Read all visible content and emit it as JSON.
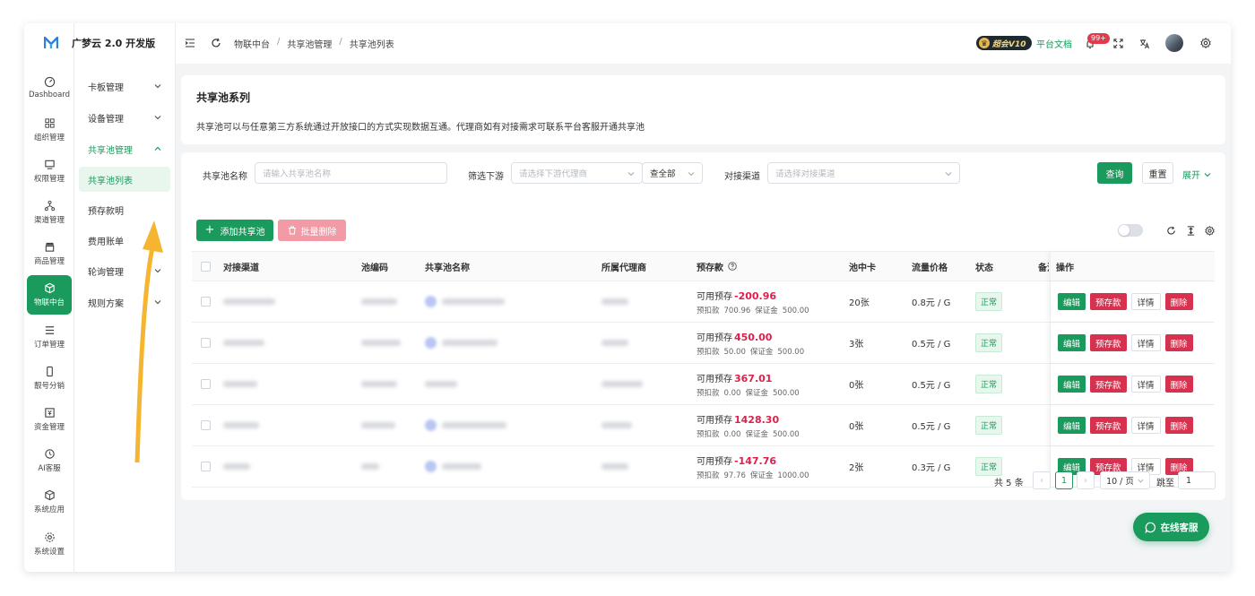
{
  "brand": {
    "name": "广梦云 2.0 开发版"
  },
  "rail": [
    {
      "label": "Dashboard",
      "icon": "dashboard-icon"
    },
    {
      "label": "组织管理",
      "icon": "grid-icon"
    },
    {
      "label": "权限管理",
      "icon": "monitor-icon"
    },
    {
      "label": "渠道管理",
      "icon": "network-icon"
    },
    {
      "label": "商品管理",
      "icon": "store-icon"
    },
    {
      "label": "物联中台",
      "icon": "cube-icon"
    },
    {
      "label": "订单管理",
      "icon": "list-icon"
    },
    {
      "label": "靓号分销",
      "icon": "phone-icon"
    },
    {
      "label": "资金管理",
      "icon": "money-icon"
    },
    {
      "label": "AI客服",
      "icon": "ai-icon"
    },
    {
      "label": "系统应用",
      "icon": "package-icon"
    },
    {
      "label": "系统设置",
      "icon": "gear-icon"
    }
  ],
  "subnav": [
    {
      "label": "卡板管理"
    },
    {
      "label": "设备管理"
    },
    {
      "label": "共享池管理"
    },
    {
      "label": "共享池列表"
    },
    {
      "label": "预存款明"
    },
    {
      "label": "费用账单"
    },
    {
      "label": "轮询管理"
    },
    {
      "label": "规则方案"
    }
  ],
  "header": {
    "breadcrumb": [
      "物联中台",
      "共享池管理",
      "共享池列表"
    ],
    "vip": "超会V10",
    "docs": "平台文档",
    "badge": "99+"
  },
  "intro": {
    "title": "共享池系列",
    "desc": "共享池可以与任意第三方系统通过开放接口的方式实现数据互通。代理商如有对接需求可联系平台客服开通共享池"
  },
  "filters": {
    "name_label": "共享池名称",
    "name_placeholder": "请输入共享池名称",
    "down_label": "筛选下游",
    "down_placeholder": "请选择下游代理商",
    "down_scope": "查全部",
    "channel_label": "对接渠道",
    "channel_placeholder": "请选择对接渠道",
    "query": "查询",
    "reset": "重置",
    "expand": "展开"
  },
  "actions": {
    "add": "添加共享池",
    "batch_delete": "批量删除"
  },
  "table": {
    "headers": [
      "对接渠道",
      "池编码",
      "共享池名称",
      "所属代理商",
      "预存款",
      "池中卡",
      "流量价格",
      "状态",
      "备注",
      "操作"
    ],
    "avail_label": "可用预存",
    "hold_label": "预扣款",
    "deposit_label": "保证金",
    "row_ops": [
      "编辑",
      "预存款",
      "详情",
      "删除"
    ],
    "rows": [
      {
        "avail": "-200.96",
        "hold": "700.96",
        "deposit": "500.00",
        "cards": "20张",
        "price": "0.8元 / G",
        "status": "正常"
      },
      {
        "avail": "450.00",
        "hold": "50.00",
        "deposit": "500.00",
        "cards": "3张",
        "price": "0.5元 / G",
        "status": "正常"
      },
      {
        "avail": "367.01",
        "hold": "0.00",
        "deposit": "500.00",
        "cards": "0张",
        "price": "0.5元 / G",
        "status": "正常"
      },
      {
        "avail": "1428.30",
        "hold": "0.00",
        "deposit": "500.00",
        "cards": "0张",
        "price": "0.5元 / G",
        "status": "正常"
      },
      {
        "avail": "-147.76",
        "hold": "97.76",
        "deposit": "1000.00",
        "cards": "2张",
        "price": "0.3元 / G",
        "status": "正常"
      }
    ]
  },
  "pagination": {
    "total": "共 5 条",
    "page": "1",
    "size": "10 / 页",
    "jump": "跳至",
    "jump_value": "1"
  },
  "chat": {
    "label": "在线客服"
  },
  "colors": {
    "primary": "#1a9a5c",
    "danger": "#d6324f",
    "negative": "#e0204a"
  }
}
